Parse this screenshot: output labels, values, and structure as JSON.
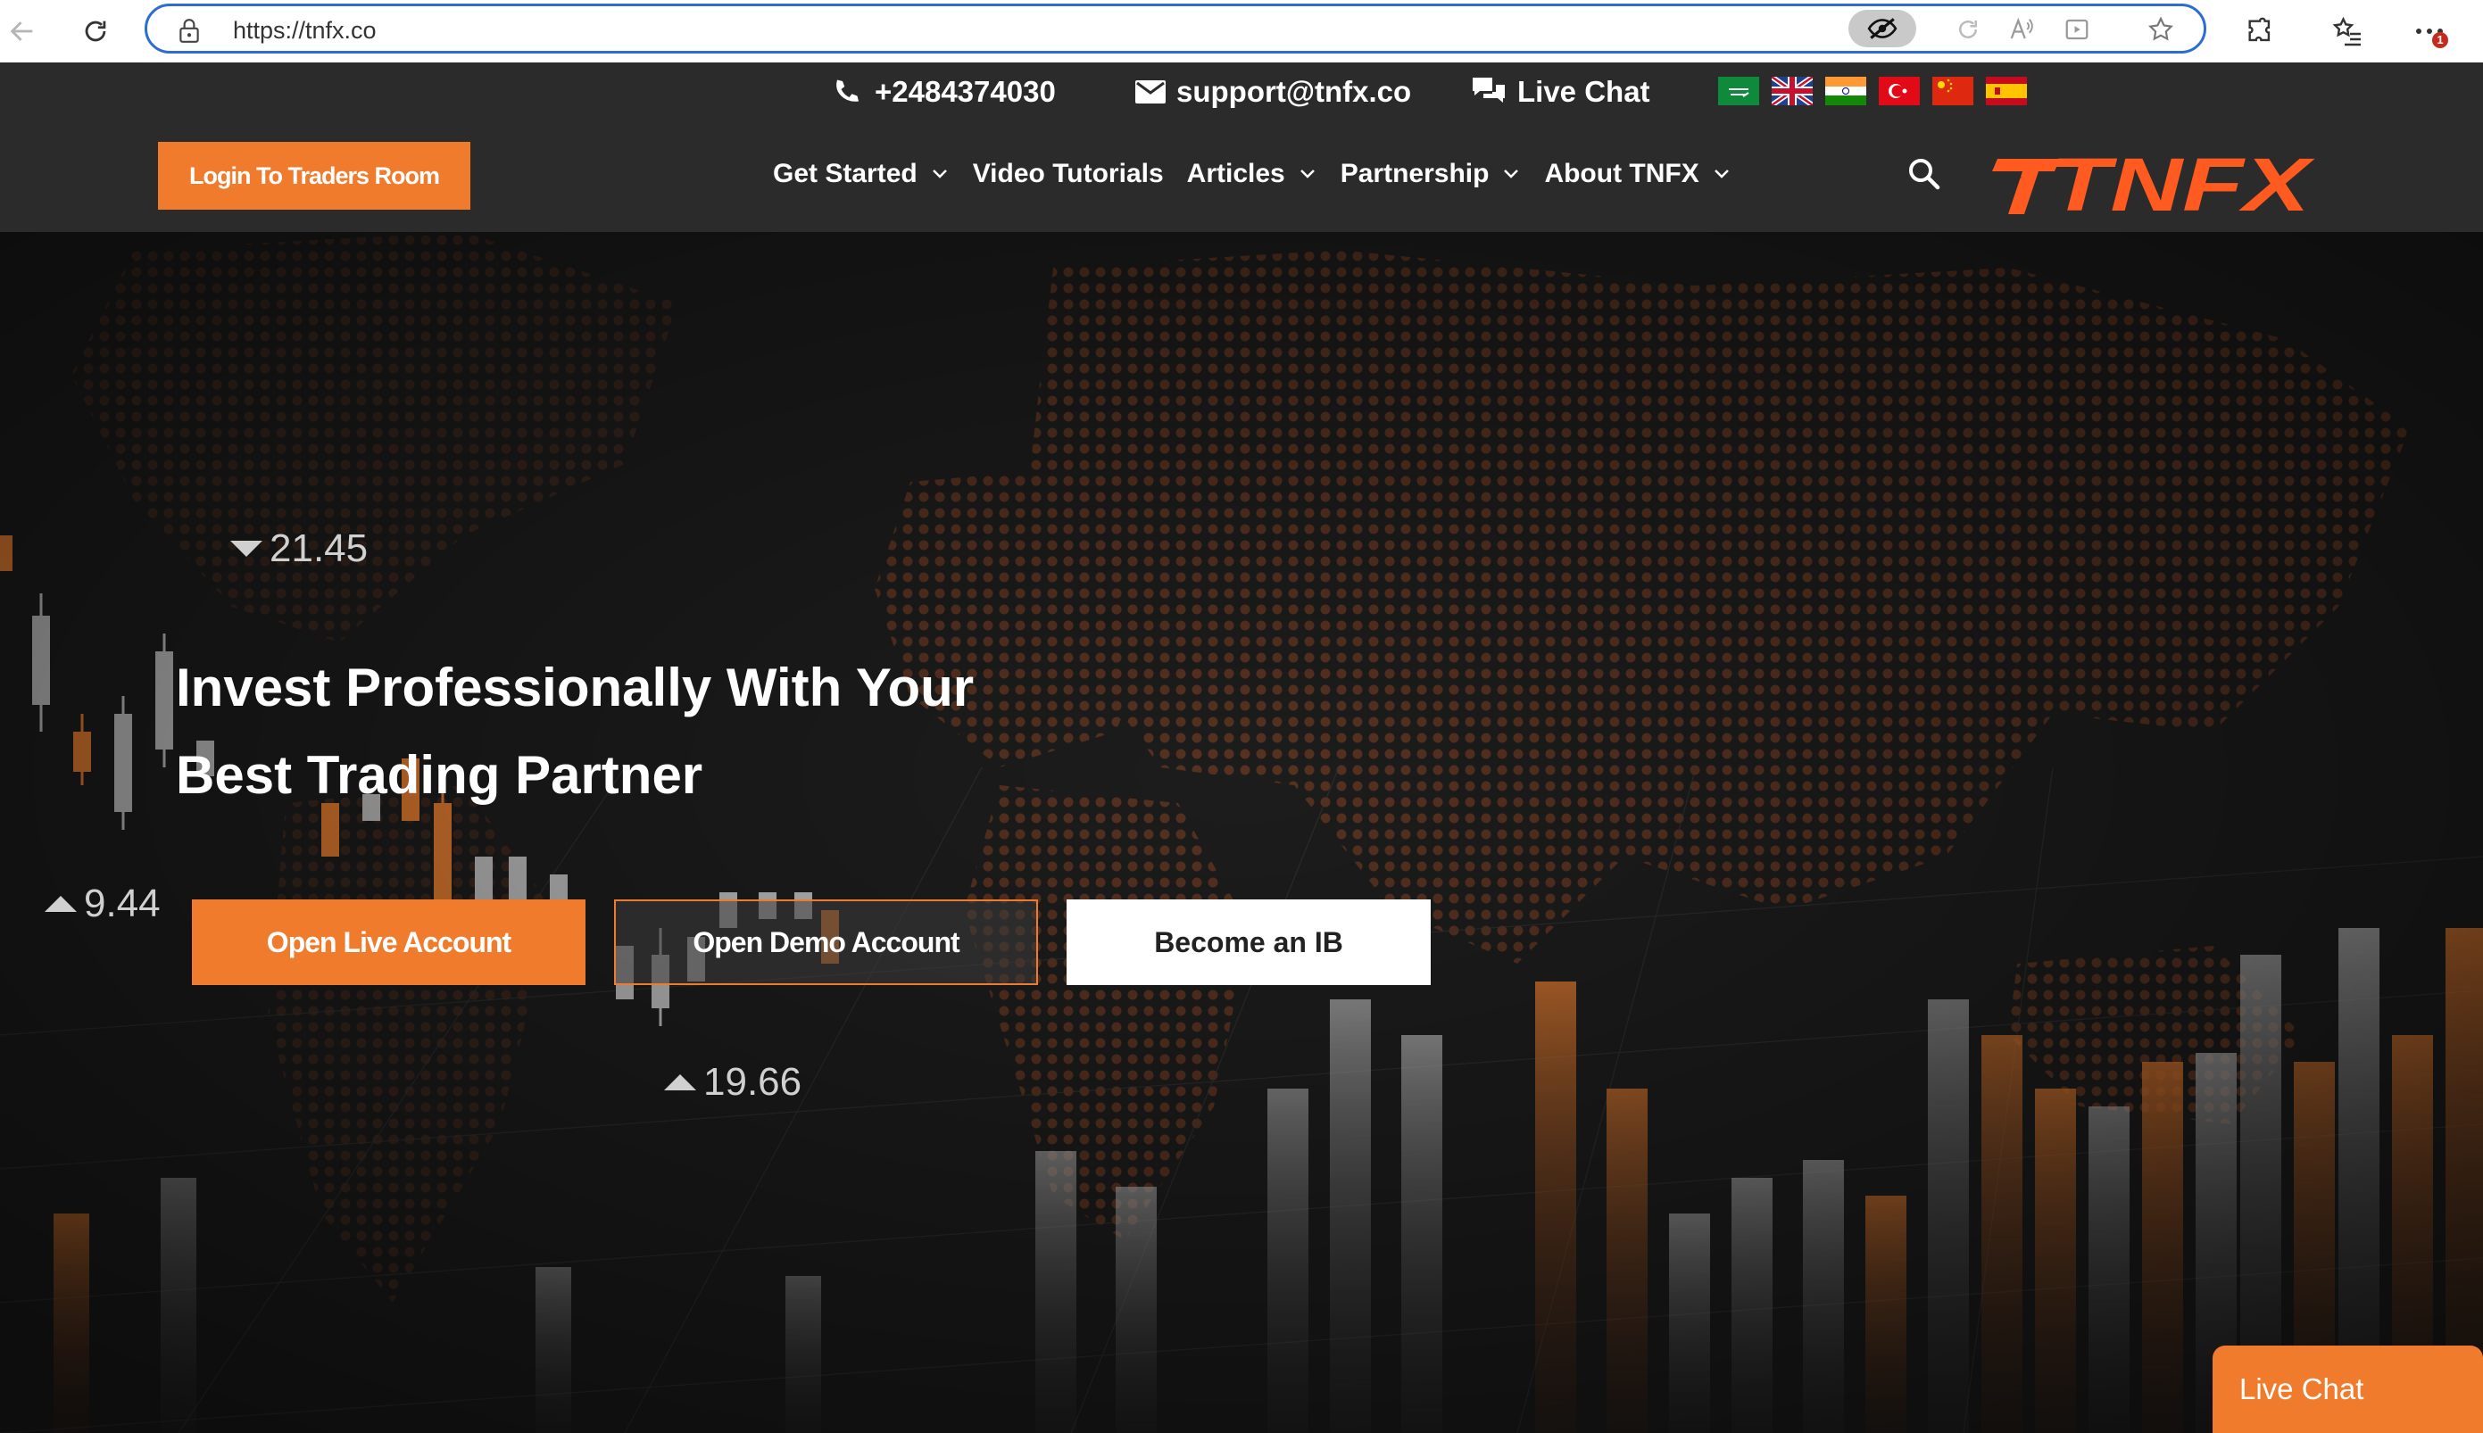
{
  "browser": {
    "url": "https://tnfx.co",
    "notification_count": "1"
  },
  "contact": {
    "phone": "+2484374030",
    "email": "support@tnfx.co",
    "live_chat": "Live Chat"
  },
  "languages": [
    "ar",
    "en",
    "hi",
    "tr",
    "zh",
    "es"
  ],
  "header": {
    "login_label": "Login To Traders Room",
    "menu": [
      {
        "label": "Get Started",
        "has_dropdown": true
      },
      {
        "label": "Video Tutorials",
        "has_dropdown": false
      },
      {
        "label": "Articles",
        "has_dropdown": true
      },
      {
        "label": "Partnership",
        "has_dropdown": true
      },
      {
        "label": "About TNFX",
        "has_dropdown": true
      }
    ],
    "logo_text": "TNFX"
  },
  "hero": {
    "headline_line1": "Invest Professionally With Your",
    "headline_line2": "Best Trading Partner",
    "tickers": [
      {
        "value": "21.45",
        "direction": "down"
      },
      {
        "value": "9.44",
        "direction": "up"
      },
      {
        "value": "19.66",
        "direction": "up"
      }
    ],
    "buttons": {
      "live": "Open Live Account",
      "demo": "Open Demo Account",
      "ib": "Become an IB"
    }
  },
  "chat_widget": {
    "label": "Live Chat"
  },
  "colors": {
    "accent": "#f07b2d",
    "header_bg": "#2b2b2b",
    "hero_bg": "#1d1d1d",
    "address_border": "#2c6dd1"
  }
}
